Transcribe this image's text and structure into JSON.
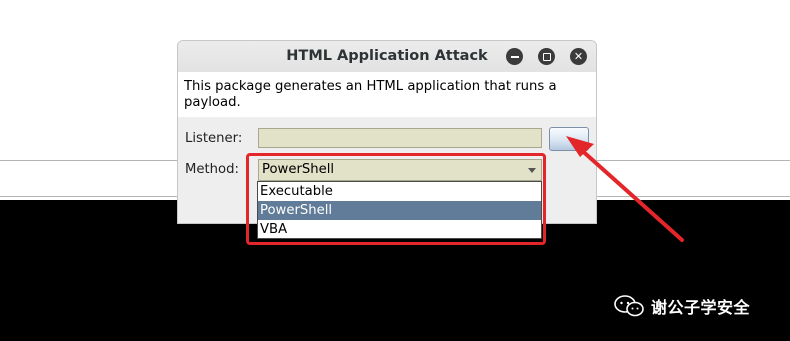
{
  "dialog": {
    "title": "HTML Application Attack",
    "description": "This package generates an HTML application that runs a payload.",
    "listener": {
      "label": "Listener:",
      "value": ""
    },
    "method": {
      "label": "Method:",
      "selected": "PowerShell",
      "options": [
        "Executable",
        "PowerShell",
        "VBA"
      ]
    }
  },
  "watermark": {
    "text": "谢公子学安全",
    "icon": "wechat-icon"
  },
  "colors": {
    "annotation": "#e3262a",
    "selection": "#617c98",
    "field_bg": "#e1e2c7"
  }
}
